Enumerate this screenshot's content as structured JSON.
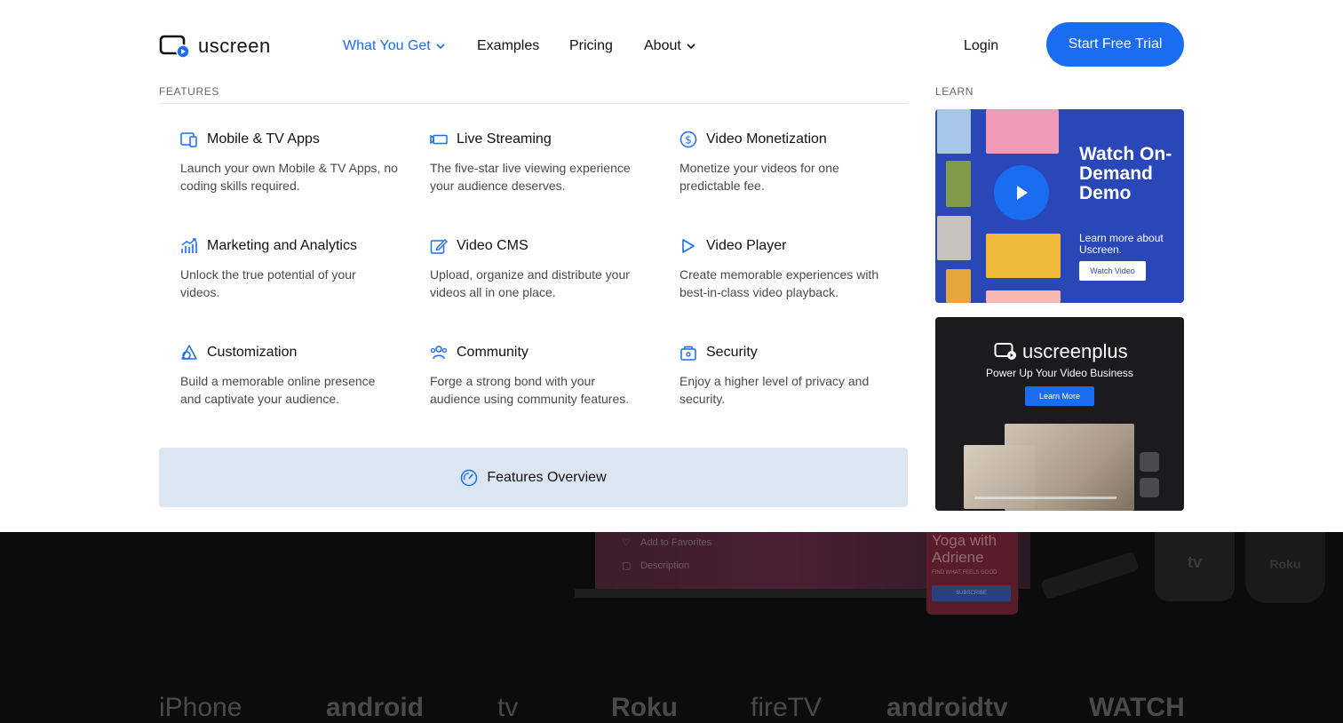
{
  "header": {
    "logo_text": "uscreen",
    "nav": [
      {
        "label": "What You Get",
        "has_dropdown": true,
        "active": true
      },
      {
        "label": "Examples",
        "has_dropdown": false
      },
      {
        "label": "Pricing",
        "has_dropdown": false
      },
      {
        "label": "About",
        "has_dropdown": true
      }
    ],
    "login_label": "Login",
    "cta_label": "Start Free Trial"
  },
  "colors": {
    "accent": "#1a6cf0",
    "overview_bg": "#dce6f2",
    "demo_card_bg": "#2a47b7",
    "plus_card_bg": "#1b1b1d"
  },
  "features": {
    "section_label": "FEATURES",
    "items": [
      {
        "icon": "devices-icon",
        "title": "Mobile & TV Apps",
        "desc": "Launch your own Mobile & TV Apps, no coding skills required."
      },
      {
        "icon": "live-stream-icon",
        "title": "Live Streaming",
        "desc": "The five-star live viewing experience your audience deserves."
      },
      {
        "icon": "dollar-icon",
        "title": "Video Monetization",
        "desc": "Monetize your videos for one predictable fee."
      },
      {
        "icon": "analytics-icon",
        "title": "Marketing and Analytics",
        "desc": "Unlock the true potential of your videos."
      },
      {
        "icon": "edit-icon",
        "title": "Video CMS",
        "desc": "Upload, organize and distribute your videos all in one place."
      },
      {
        "icon": "play-icon",
        "title": "Video Player",
        "desc": "Create memorable experiences with best-in-class video playback."
      },
      {
        "icon": "customization-icon",
        "title": "Customization",
        "desc": "Build a memorable online presence and captivate your audience."
      },
      {
        "icon": "community-icon",
        "title": "Community",
        "desc": "Forge a strong bond with your audience using community features."
      },
      {
        "icon": "lock-icon",
        "title": "Security",
        "desc": "Enjoy a higher level of privacy and security."
      }
    ],
    "overview_label": "Features Overview"
  },
  "learn": {
    "section_label": "LEARN",
    "demo_card": {
      "title": "Watch On-Demand Demo",
      "subtitle": "Learn more about Uscreen.",
      "button_label": "Watch Video"
    },
    "plus_card": {
      "logo_text": "uscreenplus",
      "subtitle": "Power Up Your Video Business",
      "button_label": "Learn More"
    }
  },
  "background": {
    "ghost_items": [
      "Add to Favorites",
      "Description"
    ],
    "yoga_title": "Yoga with Adriene",
    "yoga_tagline": "FIND WHAT FEELS GOOD",
    "yoga_button": "SUBSCRIBE",
    "device_labels": [
      "tv",
      "Roku"
    ],
    "platforms": [
      "iPhone",
      "android",
      "tv",
      "Roku",
      "fireTV",
      "androidtv",
      "WATCH"
    ]
  }
}
